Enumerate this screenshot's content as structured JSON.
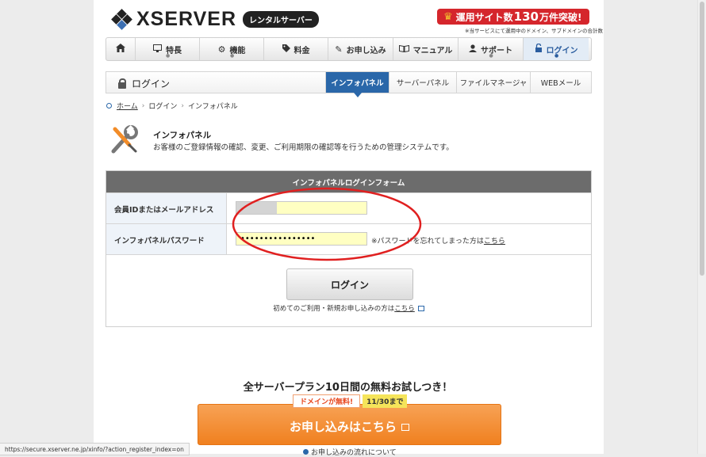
{
  "header": {
    "logo_text": "XSERVER",
    "logo_tag": "レンタルサーバー",
    "badge": {
      "prefix": "運用サイト数",
      "number": "130",
      "suffix": "万件突破!"
    },
    "badge_note": "※当サービスにて運用中のドメイン、サブドメインの合計数"
  },
  "nav": {
    "items": [
      {
        "label": "",
        "icon": "home-icon"
      },
      {
        "label": "特長",
        "icon": "monitor-icon"
      },
      {
        "label": "機能",
        "icon": "gears-icon"
      },
      {
        "label": "料金",
        "icon": "tag-icon"
      },
      {
        "label": "お申し込み",
        "icon": "pencil-icon"
      },
      {
        "label": "マニュアル",
        "icon": "book-icon"
      },
      {
        "label": "サポート",
        "icon": "person-icon"
      },
      {
        "label": "ログイン",
        "icon": "lock-icon"
      }
    ]
  },
  "subbar": {
    "title": "ログイン",
    "tabs": [
      "インフォパネル",
      "サーバーパネル",
      "ファイルマネージャ",
      "WEBメール"
    ]
  },
  "breadcrumb": {
    "home": "ホーム",
    "login": "ログイン",
    "current": "インフォパネル"
  },
  "intro": {
    "title": "インフォパネル",
    "desc": "お客様のご登録情報の確認、変更、ご利用期限の確認等を行うための管理システムです。"
  },
  "form": {
    "heading": "インフォパネルログインフォーム",
    "id_label": "会員IDまたはメールアドレス",
    "id_value": "",
    "password_label": "インフォパネルパスワード",
    "password_value": "••••••••••••••••",
    "forgot_prefix": "※パスワードを忘れてしまった方は",
    "forgot_link": "こちら",
    "login_button": "ログイン",
    "register_prefix": "初めてのご利用・新規お申し込みの方は",
    "register_link": "こちら"
  },
  "promo": {
    "title": "全サーバープラン10日間の無料お試しつき！",
    "tag_free": "ドメインが無料!",
    "tag_date": "11/30まで",
    "button": "お申し込みはこちら",
    "flow_link": "お申し込みの流れについて"
  },
  "status_url": "https://secure.xserver.ne.jp/xinfo/?action_register_index=on",
  "colors": {
    "accent": "#2a67a9",
    "brand_red": "#d5262c",
    "orange": "#f0801f",
    "annotation": "#e02020"
  }
}
